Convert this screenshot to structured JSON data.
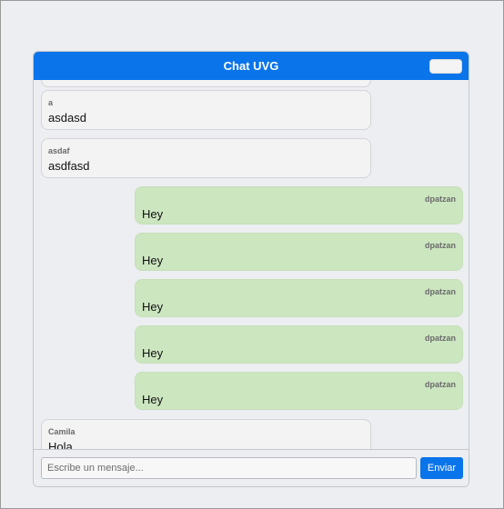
{
  "header": {
    "title": "Chat UVG",
    "button_label": ""
  },
  "messages": [
    {
      "sender": "",
      "text": "",
      "type": "received"
    },
    {
      "sender": "a",
      "text": "asdasd",
      "type": "received"
    },
    {
      "sender": "asdaf",
      "text": "asdfasd",
      "type": "received"
    },
    {
      "sender": "dpatzan",
      "text": "Hey",
      "type": "sent"
    },
    {
      "sender": "dpatzan",
      "text": "Hey",
      "type": "sent"
    },
    {
      "sender": "dpatzan",
      "text": "Hey",
      "type": "sent"
    },
    {
      "sender": "dpatzan",
      "text": "Hey",
      "type": "sent"
    },
    {
      "sender": "dpatzan",
      "text": "Hey",
      "type": "sent"
    },
    {
      "sender": "Camila",
      "text": "Hola",
      "type": "received"
    }
  ],
  "input": {
    "placeholder": "Escribe un mensaje...",
    "value": ""
  },
  "send_button": {
    "label": "Enviar"
  },
  "colors": {
    "accent": "#0a74ea",
    "sent_bubble": "#cce6c0",
    "received_bubble": "#f3f3f4"
  }
}
